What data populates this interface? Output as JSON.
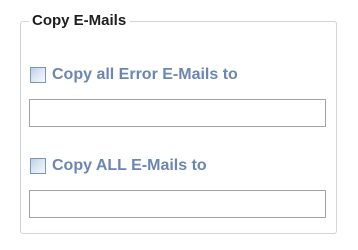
{
  "group": {
    "title": "Copy E-Mails"
  },
  "options": [
    {
      "label": "Copy all Error E-Mails to",
      "checked": false,
      "value": "",
      "placeholder": ""
    },
    {
      "label": "Copy ALL E-Mails to",
      "checked": false,
      "value": "",
      "placeholder": ""
    }
  ],
  "colors": {
    "label_text": "#6b86b2",
    "group_border": "#cfd6e1",
    "field_border": "#a4a4a4"
  }
}
